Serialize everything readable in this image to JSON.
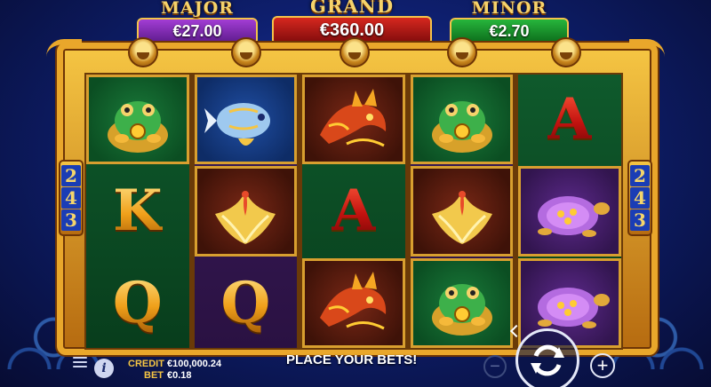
{
  "jackpots": {
    "major": {
      "label": "MAJOR",
      "value": "€27.00"
    },
    "grand": {
      "label": "GRAND",
      "value": "€360.00"
    },
    "minor": {
      "label": "MINOR",
      "value": "€2.70"
    }
  },
  "ways": [
    "2",
    "4",
    "3"
  ],
  "reels": [
    [
      "toad",
      "K",
      "Q"
    ],
    [
      "koi-fish",
      "phoenix",
      "Q"
    ],
    [
      "dragon",
      "A",
      "dragon"
    ],
    [
      "toad",
      "phoenix",
      "toad"
    ],
    [
      "A",
      "turtle",
      "turtle"
    ]
  ],
  "status": {
    "message": "PLACE YOUR BETS!",
    "credit_label": "CREDIT",
    "credit_value": "€100,000.24",
    "bet_label": "BET",
    "bet_value": "€0.18"
  },
  "controls": {
    "minus": "−",
    "plus": "+",
    "info": "i",
    "spin": "spin-icon"
  },
  "colors": {
    "frame_gold": "#e9a72b",
    "major": "#a23dd4",
    "grand": "#d6281f",
    "minor": "#27b53c",
    "background": "#0e1f6e"
  }
}
